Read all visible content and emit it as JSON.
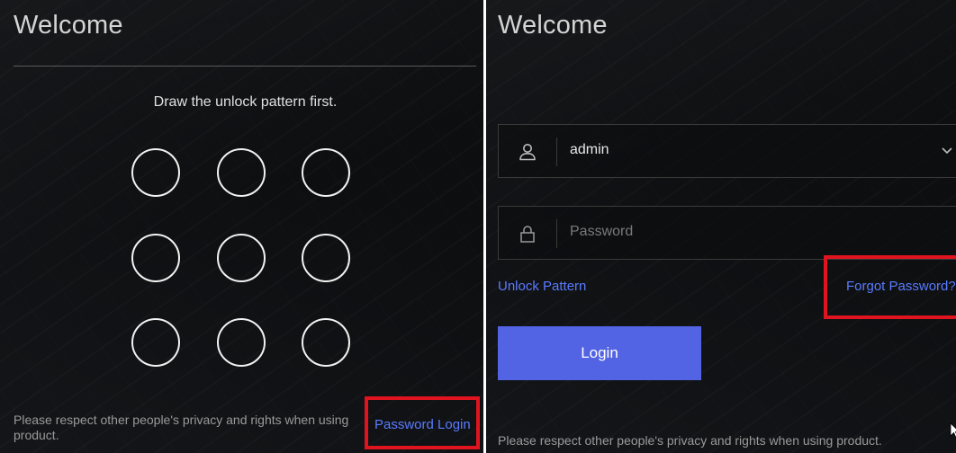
{
  "left": {
    "title": "Welcome",
    "instruction": "Draw the unlock pattern first.",
    "privacy_text": "Please respect other people's privacy and rights when using product.",
    "password_login_label": "Password Login",
    "pattern_dots": 9
  },
  "right": {
    "title": "Welcome",
    "username": {
      "value": "admin",
      "icon": "user-icon",
      "dropdown_icon": "chevron-down-icon"
    },
    "password": {
      "placeholder": "Password",
      "icon": "lock-icon"
    },
    "unlock_pattern_label": "Unlock Pattern",
    "forgot_password_label": "Forgot Password?",
    "login_label": "Login",
    "privacy_text": "Please respect other people's privacy and rights when using product."
  },
  "colors": {
    "accent": "#5263e3",
    "link": "#5a7bff",
    "highlight": "#e0141e",
    "background": "#0e0f11"
  }
}
